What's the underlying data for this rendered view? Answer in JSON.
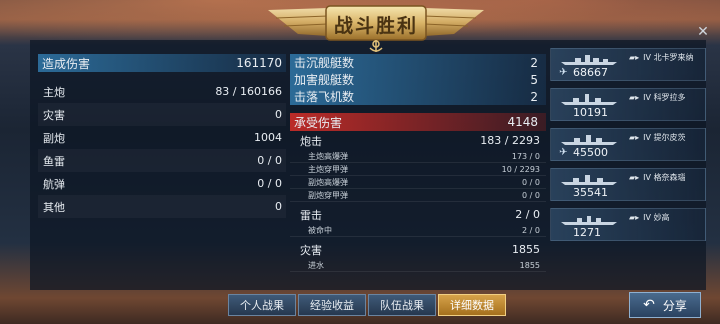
{
  "title": "战斗胜利",
  "left": {
    "header": {
      "label": "造成伤害",
      "value": "161170"
    },
    "rows": [
      {
        "label": "主炮",
        "value": "83 / 160166"
      },
      {
        "label": "灾害",
        "value": "0"
      },
      {
        "label": "副炮",
        "value": "1004"
      },
      {
        "label": "鱼雷",
        "value": "0 / 0"
      },
      {
        "label": "航弹",
        "value": "0 / 0"
      },
      {
        "label": "其他",
        "value": "0"
      }
    ]
  },
  "middle": {
    "stats": [
      {
        "label": "击沉舰艇数",
        "value": "2"
      },
      {
        "label": "加害舰艇数",
        "value": "5"
      },
      {
        "label": "击落飞机数",
        "value": "2"
      }
    ],
    "received": {
      "label": "承受伤害",
      "value": "4148"
    },
    "groups": [
      {
        "label": "炮击",
        "value": "183 / 2293",
        "subs": [
          {
            "label": "主炮高爆弹",
            "value": "173 / 0"
          },
          {
            "label": "主炮穿甲弹",
            "value": "10 / 2293"
          },
          {
            "label": "副炮高爆弹",
            "value": "0 / 0"
          },
          {
            "label": "副炮穿甲弹",
            "value": "0 / 0"
          }
        ]
      },
      {
        "label": "雷击",
        "value": "2 / 0",
        "subs": [
          {
            "label": "被命中",
            "value": "2 / 0"
          }
        ]
      },
      {
        "label": "灾害",
        "value": "1855",
        "subs": [
          {
            "label": "进水",
            "value": "1855"
          }
        ]
      }
    ]
  },
  "ships": [
    {
      "tier": "IV",
      "name": "北卡罗来纳",
      "damage": "68667",
      "plane": true
    },
    {
      "tier": "IV",
      "name": "科罗拉多",
      "damage": "10191",
      "plane": false
    },
    {
      "tier": "IV",
      "name": "提尔皮茨",
      "damage": "45500",
      "plane": true
    },
    {
      "tier": "IV",
      "name": "格奈森瑙",
      "damage": "35541",
      "plane": false
    },
    {
      "tier": "IV",
      "name": "妙高",
      "damage": "1271",
      "plane": false
    }
  ],
  "tabs": [
    {
      "label": "个人战果",
      "active": false
    },
    {
      "label": "经验收益",
      "active": false
    },
    {
      "label": "队伍战果",
      "active": false
    },
    {
      "label": "详细数据",
      "active": true
    }
  ],
  "share": {
    "label": "分享"
  },
  "icons": {
    "close": "close-icon",
    "share": "share-arrow-icon",
    "plane": "plane-icon",
    "camera": "camera-icon"
  },
  "colors": {
    "accent_blue": "#3078aa",
    "accent_red": "#c42c28",
    "active_tab": "#d6a24a"
  }
}
